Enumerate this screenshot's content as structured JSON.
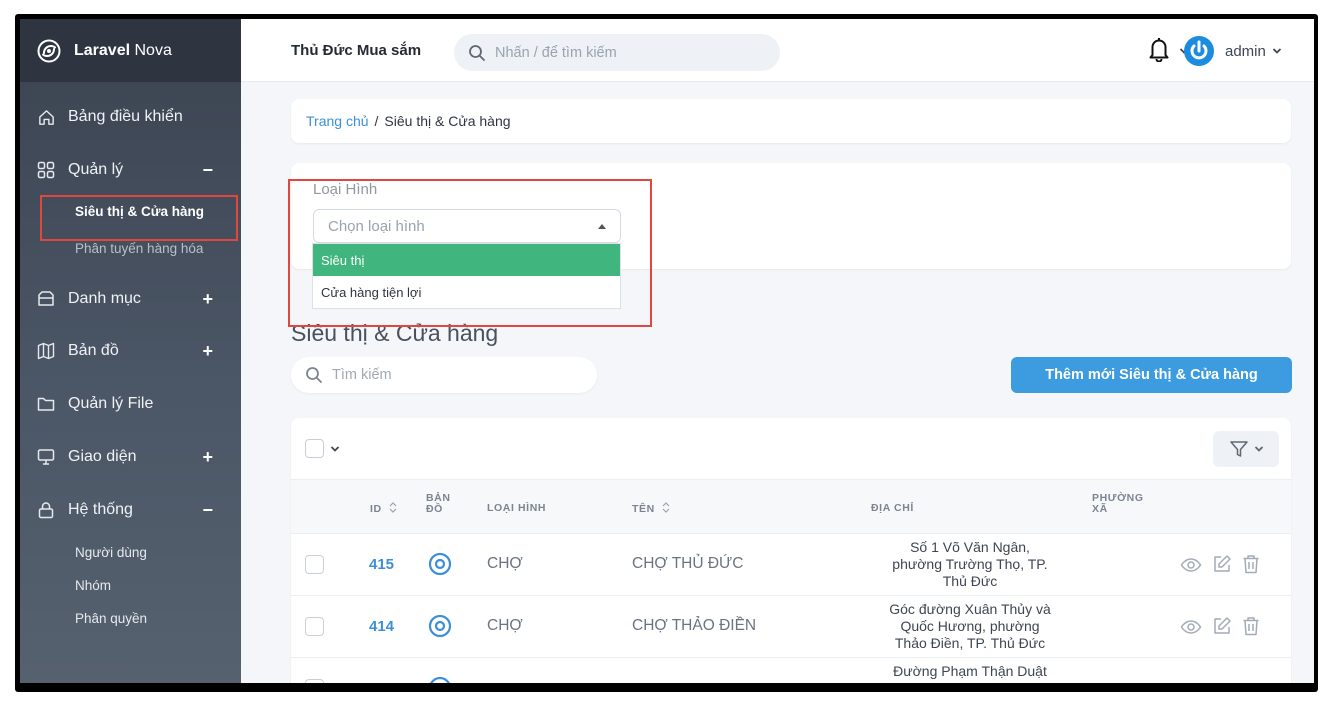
{
  "app": {
    "brand_bold": "Laravel",
    "brand_rest": "Nova"
  },
  "header": {
    "team_name": "Thủ Đức Mua sắm",
    "search_placeholder": "Nhấn / để tìm kiếm",
    "user_name": "admin"
  },
  "sidebar": {
    "items": [
      {
        "label": "Bảng điều khiển",
        "toggle": ""
      },
      {
        "label": "Quản lý",
        "toggle": "−"
      },
      {
        "label": "Danh mục",
        "toggle": "+"
      },
      {
        "label": "Bản đồ",
        "toggle": "+"
      },
      {
        "label": "Quản lý File",
        "toggle": ""
      },
      {
        "label": "Giao diện",
        "toggle": "+"
      },
      {
        "label": "Hệ thống",
        "toggle": "−"
      }
    ],
    "quanly_sub": [
      "Siêu thị & Cửa hàng",
      "Phân tuyến hàng hóa"
    ],
    "hethong_sub": [
      "Người dùng",
      "Nhóm",
      "Phân quyền"
    ]
  },
  "breadcrumb": {
    "home": "Trang chủ",
    "separator": "/",
    "current": "Siêu thị & Cửa hàng"
  },
  "filter": {
    "label": "Loại Hình",
    "placeholder": "Chọn loại hình",
    "options": [
      "Siêu thị",
      "Cửa hàng tiện lợi"
    ],
    "highlighted_option": "Siêu thị"
  },
  "resource": {
    "title": "Siêu thị & Cửa hàng",
    "search_placeholder": "Tìm kiếm",
    "add_button": "Thêm mới Siêu thị & Cửa hàng"
  },
  "table": {
    "columns": {
      "id": "ID",
      "map_line1": "BẢN",
      "map_line2": "ĐỒ",
      "type": "LOẠI HÌNH",
      "name": "TÊN",
      "address": "ĐỊA CHỈ",
      "ward_line1": "PHƯỜNG",
      "ward_line2": "XÃ"
    },
    "rows": [
      {
        "id": "415",
        "type": "CHỢ",
        "name": "CHỢ THỦ ĐỨC",
        "addr1": "Số 1 Võ Văn Ngân,",
        "addr2": "phường Trường Thọ, TP.",
        "addr3": "Thủ Đức"
      },
      {
        "id": "414",
        "type": "CHỢ",
        "name": "CHỢ THẢO ĐIỀN",
        "addr1": "Góc đường Xuân Thủy và",
        "addr2": "Quốc Hương, phường",
        "addr3": "Thảo Điền, TP. Thủ Đức"
      },
      {
        "id": "",
        "type": "",
        "name": "",
        "addr1": "Đường Phạm Thận Duật",
        "addr2": "",
        "addr3": ""
      }
    ]
  },
  "colors": {
    "accent": "#3d9be0",
    "selected_option": "#40b57d",
    "highlight": "#e0473f",
    "sidebar": "#3b4350"
  }
}
